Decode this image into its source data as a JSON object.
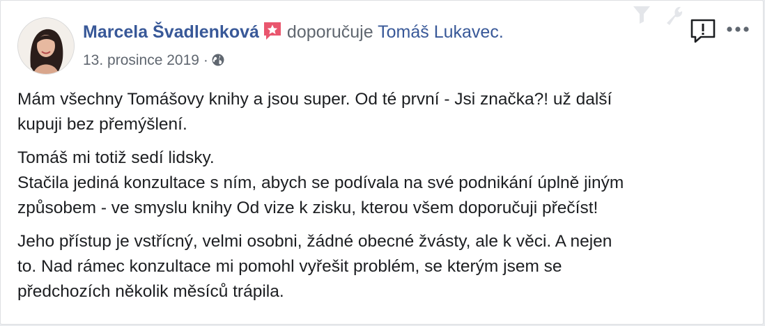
{
  "post": {
    "author": "Marcela Švadlenková",
    "verb": "doporučuje",
    "target": "Tomáš Lukavec.",
    "date": "13. prosince 2019",
    "separator": "·",
    "paragraphs": [
      {
        "line1": "Mám všechny Tomášovy knihy a jsou super. Od té první - Jsi značka?! už další",
        "line2": "kupuji bez přemýšlení."
      },
      {
        "line1": "Tomáš mi totiž sedí lidsky.",
        "line2": "Stačila jediná konzultace s ním, abych se podívala na své podnikání úplně jiným",
        "line3": "způsobem - ve smyslu knihy Od vize k zisku, kterou všem doporučuji přečíst!"
      },
      {
        "line1": "Jeho přístup je vstřícný, velmi osobni, žádné obecné žvásty, ale k věci. A nejen",
        "line2": "to. Nad rámec konzultace mi pomohl vyřešit problém, se kterým jsem se",
        "line3": "předchozích několik měsíců trápila."
      }
    ]
  },
  "icons": {
    "badge": "recommendation-star-icon",
    "privacy": "globe-icon",
    "report": "report-speech-bubble-icon",
    "more": "more-dots-icon",
    "filter": "filter-icon",
    "wrench": "wrench-icon"
  },
  "colors": {
    "link": "#385898",
    "meta": "#606770",
    "text": "#1c1e21",
    "badge": "#e9566e"
  }
}
